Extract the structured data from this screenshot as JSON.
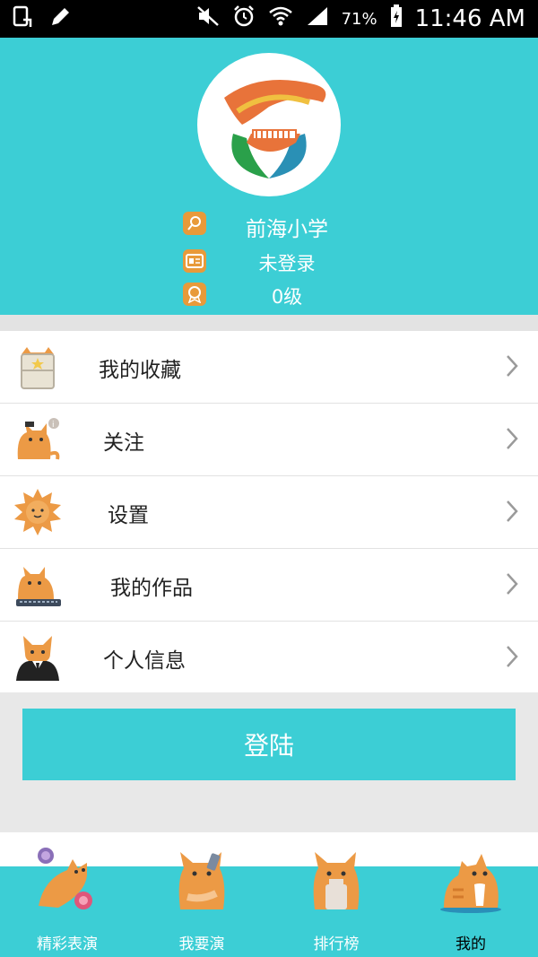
{
  "status_bar": {
    "battery_percent": "71%",
    "time": "11:46 AM"
  },
  "profile": {
    "school": "前海小学",
    "login_status": "未登录",
    "level": "0级"
  },
  "menu": {
    "items": [
      {
        "label": "我的收藏",
        "icon": "cat-cabinet-icon"
      },
      {
        "label": "关注",
        "icon": "cat-follow-icon"
      },
      {
        "label": "设置",
        "icon": "sun-cat-icon"
      },
      {
        "label": "我的作品",
        "icon": "cat-keyboard-icon"
      },
      {
        "label": "个人信息",
        "icon": "cat-suit-icon"
      }
    ]
  },
  "login_button": "登陆",
  "tabbar": {
    "tabs": [
      {
        "label": "精彩表演",
        "active": false
      },
      {
        "label": "我要演",
        "active": false
      },
      {
        "label": "排行榜",
        "active": false
      },
      {
        "label": "我的",
        "active": true
      }
    ]
  },
  "colors": {
    "accent": "#3cced5",
    "icon_orange": "#e89a3a",
    "cat_orange": "#ec9a45"
  }
}
